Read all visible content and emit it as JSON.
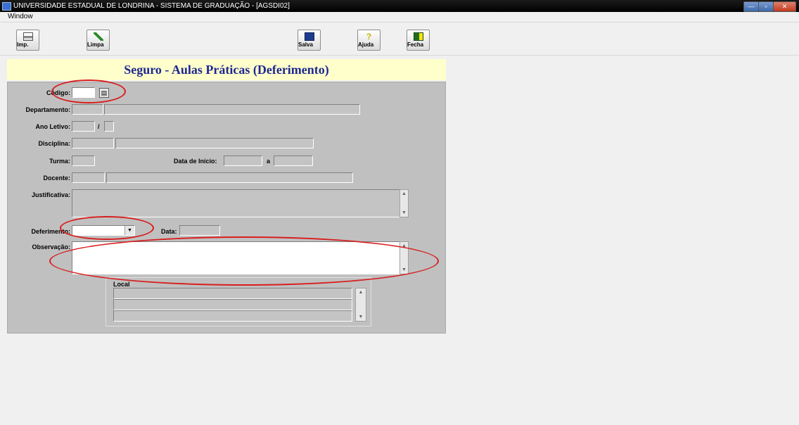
{
  "window": {
    "title": "UNIVERSIDADE ESTADUAL DE LONDRINA - SISTEMA DE GRADUAÇÃO - [AGSDI02]",
    "menu": [
      "Window"
    ]
  },
  "toolbar": {
    "print_label": "Imp.",
    "clear_label": "Limpa",
    "save_label": "Salva",
    "help_label": "Ajuda",
    "exit_label": "Fecha"
  },
  "form": {
    "title": "Seguro - Aulas Práticas (Deferimento)",
    "labels": {
      "codigo": "Código:",
      "departamento": "Departamento:",
      "ano_letivo": "Ano Letivo:",
      "ano_sep": "/",
      "disciplina": "Disciplina:",
      "turma": "Turma:",
      "data_inicio": "Data de  Início:",
      "data_sep": "a",
      "docente": "Docente:",
      "justificativa": "Justificativa:",
      "deferimento": "Deferimento:",
      "data": "Data:",
      "observacao": "Observação:",
      "local": "Local"
    }
  },
  "colors": {
    "title_text": "#1e2891",
    "title_bg": "#ffffcc",
    "panel_bg": "#c0c0c0",
    "annotation": "#d81e1e"
  }
}
